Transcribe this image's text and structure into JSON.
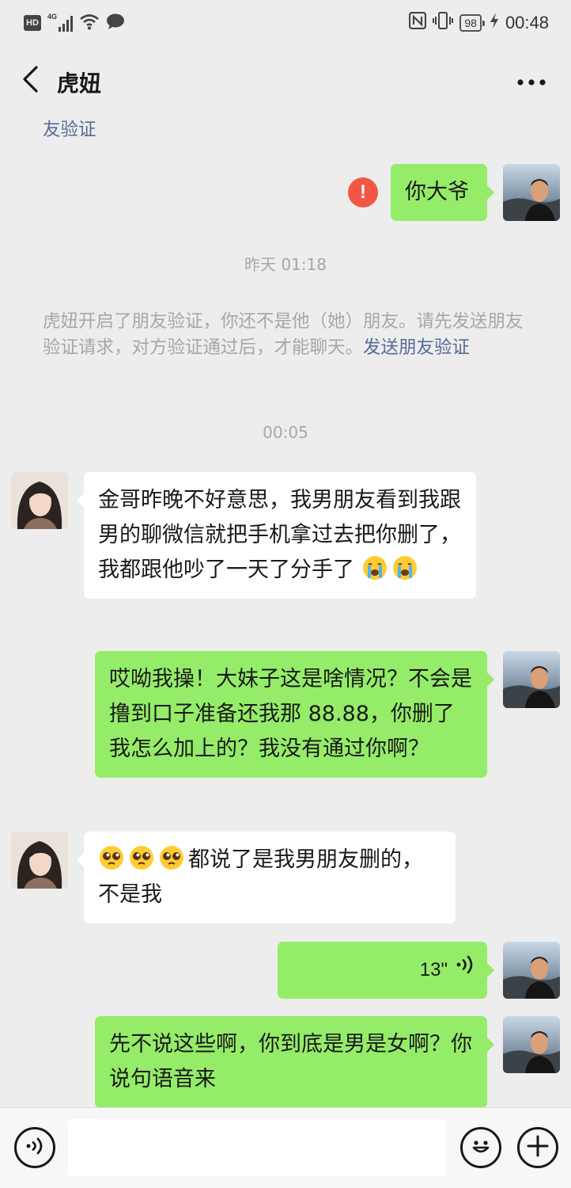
{
  "status_bar": {
    "hd_badge": "HD",
    "network": "4G",
    "time": "00:48",
    "battery": "98",
    "icons": [
      "hd-icon",
      "signal-icon",
      "wifi-icon",
      "chat-bubble-icon",
      "nfc-icon",
      "vibrate-icon",
      "battery-icon",
      "charging-icon"
    ]
  },
  "header": {
    "title": "虎妞",
    "back_icon": "chevron-left-icon",
    "more_icon": "more-dots-icon"
  },
  "messages": [
    {
      "type": "system_partial",
      "link": "友验证"
    },
    {
      "type": "text",
      "from": "me",
      "text": "你大爷",
      "status": "send-failed"
    },
    {
      "type": "time",
      "text": "昨天 01:18"
    },
    {
      "type": "system",
      "text": "虎妞开启了朋友验证，你还不是他（她）朋友。请先发送朋友验证请求，对方验证通过后，才能聊天。",
      "link": "发送朋友验证"
    },
    {
      "type": "time",
      "text": "00:05"
    },
    {
      "type": "text",
      "from": "her",
      "text": "金哥昨晚不好意思，我男朋友看到我跟男的聊微信就把手机拿过去把你删了，我都跟他吵了一天了分手了",
      "emojis": [
        "crying-face",
        "crying-face"
      ]
    },
    {
      "type": "text",
      "from": "me",
      "text": "哎呦我操！大妹子这是啥情况？不会是撸到口子准备还我那 88.88，你删了我怎么加上的？我没有通过你啊？"
    },
    {
      "type": "text",
      "from": "her",
      "lead_emojis": [
        "pleading-face",
        "pleading-face",
        "pleading-face"
      ],
      "text": "都说了是我男朋友删的，不是我"
    },
    {
      "type": "voice",
      "from": "me",
      "duration": "13\""
    },
    {
      "type": "text",
      "from": "me",
      "text": "先不说这些啊，你到底是男是女啊？你说句语音来"
    }
  ],
  "input_bar": {
    "voice_icon": "voice-input-icon",
    "emoji_icon": "emoji-icon",
    "plus_icon": "plus-icon",
    "value": ""
  },
  "colors": {
    "background": "#ededed",
    "my_bubble": "#95ec69",
    "her_bubble": "#ffffff",
    "link": "#576b95",
    "system_text": "#a7a7a7",
    "error_red": "#f25745"
  }
}
